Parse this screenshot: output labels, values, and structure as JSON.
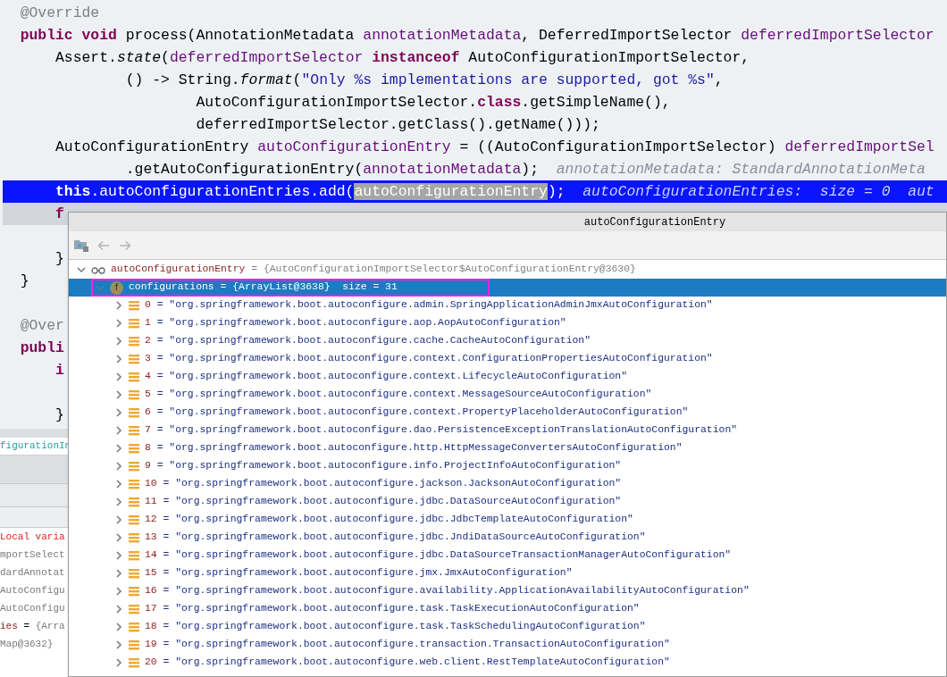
{
  "editor": {
    "lines": [
      {
        "selected": false,
        "segments": [
          {
            "kind": "annotation",
            "text": "  @Override"
          }
        ]
      },
      {
        "selected": false,
        "segments": [
          {
            "kind": "kw",
            "text": "  public void "
          },
          {
            "kind": "plain",
            "text": "process(AnnotationMetadata "
          },
          {
            "kind": "param",
            "text": "annotationMetadata"
          },
          {
            "kind": "plain",
            "text": ", DeferredImportSelector "
          },
          {
            "kind": "param",
            "text": "deferredImportSelector"
          }
        ]
      },
      {
        "selected": false,
        "segments": [
          {
            "kind": "plain",
            "text": "      Assert."
          },
          {
            "kind": "italic",
            "text": "state"
          },
          {
            "kind": "plain",
            "text": "("
          },
          {
            "kind": "param",
            "text": "deferredImportSelector"
          },
          {
            "kind": "kw",
            "text": " instanceof "
          },
          {
            "kind": "plain",
            "text": "AutoConfigurationImportSelector,"
          }
        ]
      },
      {
        "selected": false,
        "segments": [
          {
            "kind": "plain",
            "text": "              () -> String."
          },
          {
            "kind": "italic",
            "text": "format"
          },
          {
            "kind": "plain",
            "text": "("
          },
          {
            "kind": "string",
            "text": "\"Only %s implementations are supported, got %s\""
          },
          {
            "kind": "plain",
            "text": ","
          }
        ]
      },
      {
        "selected": false,
        "segments": [
          {
            "kind": "plain",
            "text": "                      AutoConfigurationImportSelector."
          },
          {
            "kind": "kw",
            "text": "class"
          },
          {
            "kind": "plain",
            "text": ".getSimpleName(),"
          }
        ]
      },
      {
        "selected": false,
        "segments": [
          {
            "kind": "plain",
            "text": "                      deferredImportSelector.getClass().getName()));"
          }
        ]
      },
      {
        "selected": false,
        "segments": [
          {
            "kind": "plain",
            "text": "      AutoConfigurationEntry "
          },
          {
            "kind": "param",
            "text": "autoConfigurationEntry"
          },
          {
            "kind": "plain",
            "text": " = ((AutoConfigurationImportSelector) "
          },
          {
            "kind": "param",
            "text": "deferredImportSel"
          }
        ]
      },
      {
        "selected": false,
        "segments": [
          {
            "kind": "plain",
            "text": "              .getAutoConfigurationEntry("
          },
          {
            "kind": "param",
            "text": "annotationMetadata"
          },
          {
            "kind": "plain",
            "text": ");"
          },
          {
            "kind": "hint",
            "text": "  annotationMetadata: StandardAnnotationMeta"
          }
        ]
      },
      {
        "selected": true,
        "segments": [
          {
            "kind": "kw",
            "text": "      this"
          },
          {
            "kind": "plain",
            "text": ".autoConfigurationEntries.add("
          },
          {
            "kind": "boxed",
            "text": "autoConfigurationEntry"
          },
          {
            "kind": "plain",
            "text": ");"
          },
          {
            "kind": "hint",
            "text": "  autoConfigurationEntries:  size = 0  aut"
          }
        ]
      },
      {
        "selected": false,
        "segments": [
          {
            "kind": "kw",
            "text": "      f"
          }
        ]
      },
      {
        "selected": false
      },
      {
        "selected": false,
        "segments": [
          {
            "kind": "plain",
            "text": "      }"
          }
        ]
      },
      {
        "selected": false,
        "segments": [
          {
            "kind": "plain",
            "text": "  }"
          }
        ]
      },
      {
        "selected": false
      },
      {
        "selected": false,
        "segments": [
          {
            "kind": "annotation",
            "text": "  @Over"
          }
        ]
      },
      {
        "selected": false,
        "segments": [
          {
            "kind": "kw",
            "text": "  publi"
          }
        ]
      },
      {
        "selected": false,
        "segments": [
          {
            "kind": "kw",
            "text": "      i"
          }
        ]
      },
      {
        "selected": false
      },
      {
        "selected": false,
        "segments": [
          {
            "kind": "plain",
            "text": "      }"
          }
        ]
      }
    ]
  },
  "debug_panel": {
    "tab": "figurationIn",
    "variables": [
      {
        "segments": [
          {
            "kind": "error",
            "text": "Local varia"
          }
        ]
      },
      {
        "segments": [
          {
            "kind": "value",
            "text": "mportSelect"
          }
        ]
      },
      {
        "segments": [
          {
            "kind": "value",
            "text": "dardAnnotat"
          }
        ]
      },
      {
        "segments": [
          {
            "kind": "value",
            "text": "AutoConfigu"
          }
        ]
      },
      {
        "segments": [
          {
            "kind": "value",
            "text": "AutoConfigu"
          }
        ]
      },
      {
        "segments": [
          {
            "kind": "name",
            "text": "ies"
          },
          {
            "kind": "plain",
            "text": " = "
          },
          {
            "kind": "value",
            "text": "{Arra"
          }
        ]
      },
      {
        "segments": [
          {
            "kind": "value",
            "text": "Map@3632}"
          }
        ]
      }
    ]
  },
  "popup": {
    "title": "autoConfigurationEntry",
    "tree": [
      {
        "kind": "watch",
        "name": "autoConfigurationEntry",
        "value": " = {AutoConfigurationImportSelector$AutoConfigurationEntry@3630}",
        "expanded": true,
        "selected": false,
        "highlighted": false,
        "children": [
          {
            "kind": "field",
            "icon_letter": "f",
            "name": "configurations",
            "value": " = {ArrayList@3638}  size = 31",
            "expanded": true,
            "selected": true,
            "highlighted": true,
            "children": [
              {
                "kind": "item",
                "name": "0",
                "value": " = \"org.springframework.boot.autoconfigure.admin.SpringApplicationAdminJmxAutoConfiguration\"",
                "expanded": false,
                "selected": false,
                "highlighted": false
              },
              {
                "kind": "item",
                "name": "1",
                "value": " = \"org.springframework.boot.autoconfigure.aop.AopAutoConfiguration\"",
                "expanded": false,
                "selected": false,
                "highlighted": false
              },
              {
                "kind": "item",
                "name": "2",
                "value": " = \"org.springframework.boot.autoconfigure.cache.CacheAutoConfiguration\"",
                "expanded": false,
                "selected": false,
                "highlighted": false
              },
              {
                "kind": "item",
                "name": "3",
                "value": " = \"org.springframework.boot.autoconfigure.context.ConfigurationPropertiesAutoConfiguration\"",
                "expanded": false,
                "selected": false,
                "highlighted": false
              },
              {
                "kind": "item",
                "name": "4",
                "value": " = \"org.springframework.boot.autoconfigure.context.LifecycleAutoConfiguration\"",
                "expanded": false,
                "selected": false,
                "highlighted": false
              },
              {
                "kind": "item",
                "name": "5",
                "value": " = \"org.springframework.boot.autoconfigure.context.MessageSourceAutoConfiguration\"",
                "expanded": false,
                "selected": false,
                "highlighted": false
              },
              {
                "kind": "item",
                "name": "6",
                "value": " = \"org.springframework.boot.autoconfigure.context.PropertyPlaceholderAutoConfiguration\"",
                "expanded": false,
                "selected": false,
                "highlighted": false
              },
              {
                "kind": "item",
                "name": "7",
                "value": " = \"org.springframework.boot.autoconfigure.dao.PersistenceExceptionTranslationAutoConfiguration\"",
                "expanded": false,
                "selected": false,
                "highlighted": false
              },
              {
                "kind": "item",
                "name": "8",
                "value": " = \"org.springframework.boot.autoconfigure.http.HttpMessageConvertersAutoConfiguration\"",
                "expanded": false,
                "selected": false,
                "highlighted": false
              },
              {
                "kind": "item",
                "name": "9",
                "value": " = \"org.springframework.boot.autoconfigure.info.ProjectInfoAutoConfiguration\"",
                "expanded": false,
                "selected": false,
                "highlighted": false
              },
              {
                "kind": "item",
                "name": "10",
                "value": " = \"org.springframework.boot.autoconfigure.jackson.JacksonAutoConfiguration\"",
                "expanded": false,
                "selected": false,
                "highlighted": false
              },
              {
                "kind": "item",
                "name": "11",
                "value": " = \"org.springframework.boot.autoconfigure.jdbc.DataSourceAutoConfiguration\"",
                "expanded": false,
                "selected": false,
                "highlighted": false
              },
              {
                "kind": "item",
                "name": "12",
                "value": " = \"org.springframework.boot.autoconfigure.jdbc.JdbcTemplateAutoConfiguration\"",
                "expanded": false,
                "selected": false,
                "highlighted": false
              },
              {
                "kind": "item",
                "name": "13",
                "value": " = \"org.springframework.boot.autoconfigure.jdbc.JndiDataSourceAutoConfiguration\"",
                "expanded": false,
                "selected": false,
                "highlighted": false
              },
              {
                "kind": "item",
                "name": "14",
                "value": " = \"org.springframework.boot.autoconfigure.jdbc.DataSourceTransactionManagerAutoConfiguration\"",
                "expanded": false,
                "selected": false,
                "highlighted": false
              },
              {
                "kind": "item",
                "name": "15",
                "value": " = \"org.springframework.boot.autoconfigure.jmx.JmxAutoConfiguration\"",
                "expanded": false,
                "selected": false,
                "highlighted": false
              },
              {
                "kind": "item",
                "name": "16",
                "value": " = \"org.springframework.boot.autoconfigure.availability.ApplicationAvailabilityAutoConfiguration\"",
                "expanded": false,
                "selected": false,
                "highlighted": false
              },
              {
                "kind": "item",
                "name": "17",
                "value": " = \"org.springframework.boot.autoconfigure.task.TaskExecutionAutoConfiguration\"",
                "expanded": false,
                "selected": false,
                "highlighted": false
              },
              {
                "kind": "item",
                "name": "18",
                "value": " = \"org.springframework.boot.autoconfigure.task.TaskSchedulingAutoConfiguration\"",
                "expanded": false,
                "selected": false,
                "highlighted": false
              },
              {
                "kind": "item",
                "name": "19",
                "value": " = \"org.springframework.boot.autoconfigure.transaction.TransactionAutoConfiguration\"",
                "expanded": false,
                "selected": false,
                "highlighted": false
              },
              {
                "kind": "item",
                "name": "20",
                "value": " = \"org.springframework.boot.autoconfigure.web.client.RestTemplateAutoConfiguration\"",
                "expanded": false,
                "selected": false,
                "highlighted": false
              }
            ]
          }
        ]
      }
    ]
  }
}
